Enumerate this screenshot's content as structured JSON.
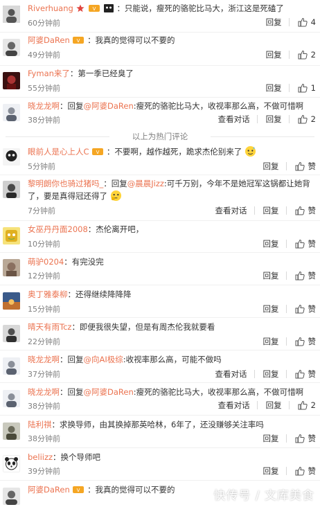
{
  "section_divider": "以上为热门评论",
  "actions": {
    "reply": "回复",
    "praise": "赞",
    "view_conversation": "查看对话"
  },
  "comments": [
    {
      "user": "Riverhuang",
      "badges": [
        "star-badge-icon",
        "crown-badge-icon",
        "mask-badge-icon"
      ],
      "text": "：只能说，瘦死的骆驼比马大，浙江这是死磕了",
      "time": "60分钟前",
      "likes": "4",
      "avatar_color": "#5a5a5a"
    },
    {
      "user": "阿婆DaRen",
      "badges": [
        "crown-badge-icon"
      ],
      "text": "：我真的觉得可以不要的",
      "time": "49分钟前",
      "likes": "2",
      "avatar_color": "#6b6b6b"
    },
    {
      "user": "Fyman来了",
      "badges": [],
      "text": "：第一季已经臭了",
      "time": "55分钟前",
      "likes": "1",
      "avatar_color": "#7a2a2a"
    },
    {
      "user": "晓龙龙啊",
      "reply_prefix": "：回复",
      "mention": "@阿婆DaRen",
      "text": ":瘦死的骆驼比马大，收视率那么高，不做可惜啊",
      "time": "38分钟前",
      "likes": "2",
      "view_conversation": true,
      "avatar_color": "#8a8f99"
    },
    {
      "user": "眼前人是心上人C",
      "badges": [
        "crown-badge-icon"
      ],
      "text": "：不要啊，越作越死，跪求杰伦别来了",
      "emoji": "sweat-emoji",
      "time": "5分钟前",
      "likes": "赞",
      "avatar_color": "#333333"
    },
    {
      "user": "黎明朗你也骑过猪吗_",
      "reply_prefix": "：回复",
      "mention": "@晨晨Jizz",
      "text": ":可千万别，今年不是她冠军这锅都让她背了，要是真得冠还得了",
      "emoji": "think-emoji",
      "time": "7分钟前",
      "likes": "赞",
      "view_conversation": true,
      "avatar_color": "#4a4a4a"
    },
    {
      "user": "女巫丹丹面2008",
      "badges": [],
      "text": "：杰伦离开吧，",
      "time": "10分钟前",
      "likes": "赞",
      "avatar_color": "#e0b020"
    },
    {
      "user": "萌驴0204",
      "badges": [],
      "text": "：有完没完",
      "time": "12分钟前",
      "likes": "赞",
      "avatar_color": "#8a7060"
    },
    {
      "user": "奥丁雅泰柳",
      "badges": [],
      "text": "：还得继续降降降",
      "time": "15分钟前",
      "likes": "赞",
      "avatar_color": "#c07030"
    },
    {
      "user": "晴天有雨Tcz",
      "badges": [],
      "text": "：即便我很失望，但是有周杰伦我就要看",
      "time": "22分钟前",
      "likes": "赞",
      "avatar_color": "#505050"
    },
    {
      "user": "晓龙龙啊",
      "reply_prefix": "：回复",
      "mention": "@向AI极综",
      "text": ":收视率那么高，可能不做吗",
      "time": "37分钟前",
      "likes": "赞",
      "view_conversation": true,
      "avatar_color": "#8a8f99"
    },
    {
      "user": "晓龙龙啊",
      "reply_prefix": "：回复",
      "mention": "@阿婆DaRen",
      "text": ":瘦死的骆驼比马大，收视率那么高，不做可惜啊",
      "time": "38分钟前",
      "likes": "2",
      "view_conversation": true,
      "avatar_color": "#8a8f99"
    },
    {
      "user": "陆利祺",
      "badges": [],
      "text": "：求换导师，由其换掉那英哈林，6年了，还没赚够关注率吗",
      "time": "38分钟前",
      "likes": "赞",
      "avatar_color": "#6a6a5a"
    },
    {
      "user": "beliizz",
      "badges": [],
      "text": "：换个导师吧",
      "time": "39分钟前",
      "likes": "赞",
      "avatar_color": "#ffffff"
    },
    {
      "user": "阿婆DaRen",
      "badges": [
        "crown-badge-icon"
      ],
      "text": "：我真的觉得可以不要的",
      "time": "",
      "likes": "",
      "avatar_color": "#6b6b6b"
    }
  ],
  "watermark": "快传号 / 文库美食"
}
